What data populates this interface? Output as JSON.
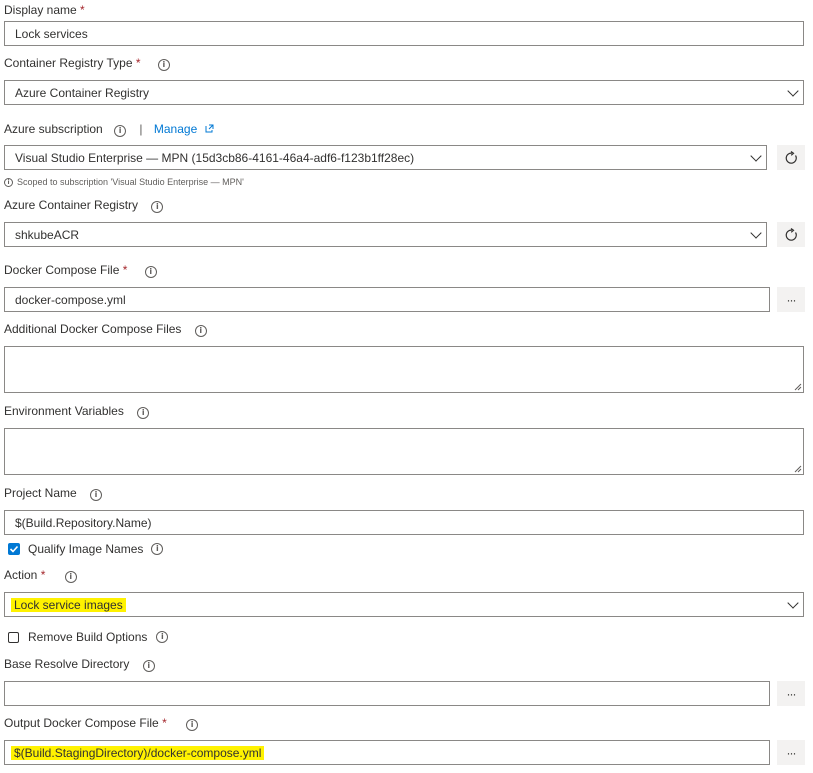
{
  "display_name": {
    "label": "Display name",
    "required": "*",
    "value": "Lock services"
  },
  "registry_type": {
    "label": "Container Registry Type",
    "required": "*",
    "value": "Azure Container Registry"
  },
  "subscription": {
    "label": "Azure subscription",
    "separator": "|",
    "manage": "Manage",
    "value": "Visual Studio Enterprise — MPN (15d3cb86-4161-46a4-adf6-f123b1ff28ec)",
    "scoped_note": "Scoped to subscription 'Visual Studio Enterprise — MPN'"
  },
  "acr": {
    "label": "Azure Container Registry",
    "value": "shkubeACR"
  },
  "compose_file": {
    "label": "Docker Compose File",
    "required": "*",
    "value": "docker-compose.yml",
    "browse": "···"
  },
  "additional_files": {
    "label": "Additional Docker Compose Files",
    "value": ""
  },
  "env_vars": {
    "label": "Environment Variables",
    "value": ""
  },
  "project_name": {
    "label": "Project Name",
    "value": "$(Build.Repository.Name)"
  },
  "qualify_images": {
    "label": "Qualify Image Names",
    "checked": true
  },
  "action": {
    "label": "Action",
    "required": "*",
    "value": "Lock service images"
  },
  "remove_build_options": {
    "label": "Remove Build Options",
    "checked": false
  },
  "base_resolve_dir": {
    "label": "Base Resolve Directory",
    "value": "",
    "browse": "···"
  },
  "output_compose_file": {
    "label": "Output Docker Compose File",
    "required": "*",
    "value": "$(Build.StagingDirectory)/docker-compose.yml",
    "browse": "···"
  },
  "icons": {
    "info": "i"
  },
  "colors": {
    "highlight": "#fff200",
    "link": "#0078d4",
    "checkbox": "#0078d4",
    "required": "#a4262c"
  }
}
